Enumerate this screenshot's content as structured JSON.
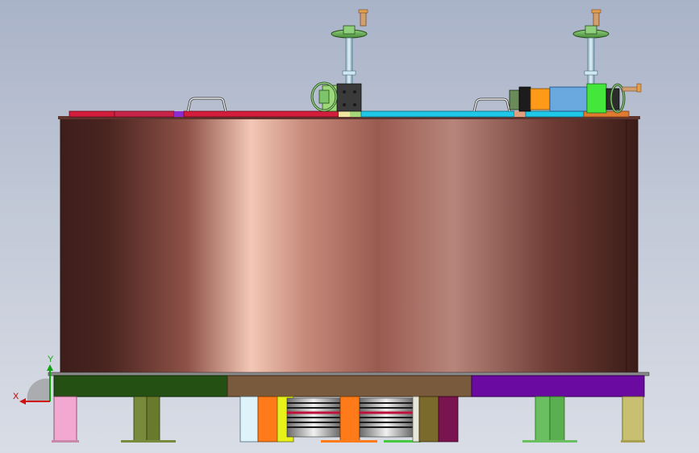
{
  "viewport": {
    "background_top": "#a9b3c8",
    "background_bottom": "#d9dde6"
  },
  "triad": {
    "x_label": "X",
    "y_label": "Y",
    "x_color": "#d01010",
    "y_color": "#10a010"
  },
  "colors": {
    "tank_body": "#a06a60",
    "tank_highlight": "#f3c7b6",
    "tank_shadow": "#4a2420",
    "deck_red": "#d21e3c",
    "deck_cyan": "#1ec8e6",
    "motor_green": "#44e63c",
    "motor_blue": "#6aa8e0",
    "handle_tan": "#d2a070",
    "base_green": "#245014",
    "base_brown": "#7a5a3c",
    "base_purple": "#6a0aa0"
  }
}
